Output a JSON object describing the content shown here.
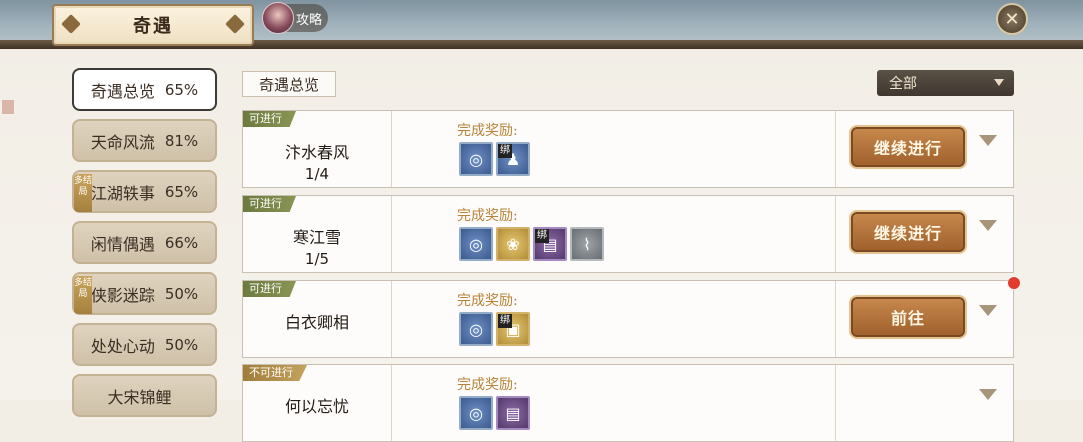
{
  "header": {
    "title": "奇遇",
    "guide_label": "攻略",
    "close_icon": "close-icon"
  },
  "sidebar": {
    "items": [
      {
        "label": "奇遇总览",
        "pct": "65%",
        "tag": ""
      },
      {
        "label": "天命风流",
        "pct": "81%",
        "tag": ""
      },
      {
        "label": "江湖轶事",
        "pct": "65%",
        "tag": "多结局"
      },
      {
        "label": "闲情偶遇",
        "pct": "66%",
        "tag": ""
      },
      {
        "label": "侠影迷踪",
        "pct": "50%",
        "tag": "多结局"
      },
      {
        "label": "处处心动",
        "pct": "50%",
        "tag": ""
      },
      {
        "label": "大宋锦鲤",
        "pct": "",
        "tag": ""
      }
    ]
  },
  "main": {
    "section_title": "奇遇总览",
    "filter_value": "全部"
  },
  "quests": [
    {
      "status": "可进行",
      "name": "汴水春风",
      "progress": "1/4",
      "reward_label": "完成奖励:",
      "rewards": [
        {
          "style": "blue",
          "bind": "",
          "icon": "jade-disc-icon"
        },
        {
          "style": "blue",
          "bind": "绑",
          "icon": "figure-icon"
        }
      ],
      "action": "继续进行"
    },
    {
      "status": "可进行",
      "name": "寒江雪",
      "progress": "1/5",
      "reward_label": "完成奖励:",
      "rewards": [
        {
          "style": "blue",
          "bind": "",
          "icon": "jade-disc-icon"
        },
        {
          "style": "gold",
          "bind": "",
          "icon": "lotus-icon"
        },
        {
          "style": "purple",
          "bind": "绑",
          "icon": "book-icon"
        },
        {
          "style": "grey",
          "bind": "",
          "icon": "scroll-icon"
        }
      ],
      "action": "继续进行"
    },
    {
      "status": "可进行",
      "name": "白衣卿相",
      "progress": "",
      "reward_label": "完成奖励:",
      "rewards": [
        {
          "style": "blue",
          "bind": "",
          "icon": "jade-disc-icon"
        },
        {
          "style": "gold",
          "bind": "绑",
          "icon": "gold-chest-icon"
        }
      ],
      "action": "前往"
    },
    {
      "status": "不可进行",
      "name": "何以忘忧",
      "progress": "",
      "reward_label": "完成奖励:",
      "rewards": [
        {
          "style": "blue",
          "bind": "",
          "icon": "jade-disc-icon"
        },
        {
          "style": "purple",
          "bind": "",
          "icon": "book-icon"
        }
      ],
      "action": ""
    }
  ]
}
